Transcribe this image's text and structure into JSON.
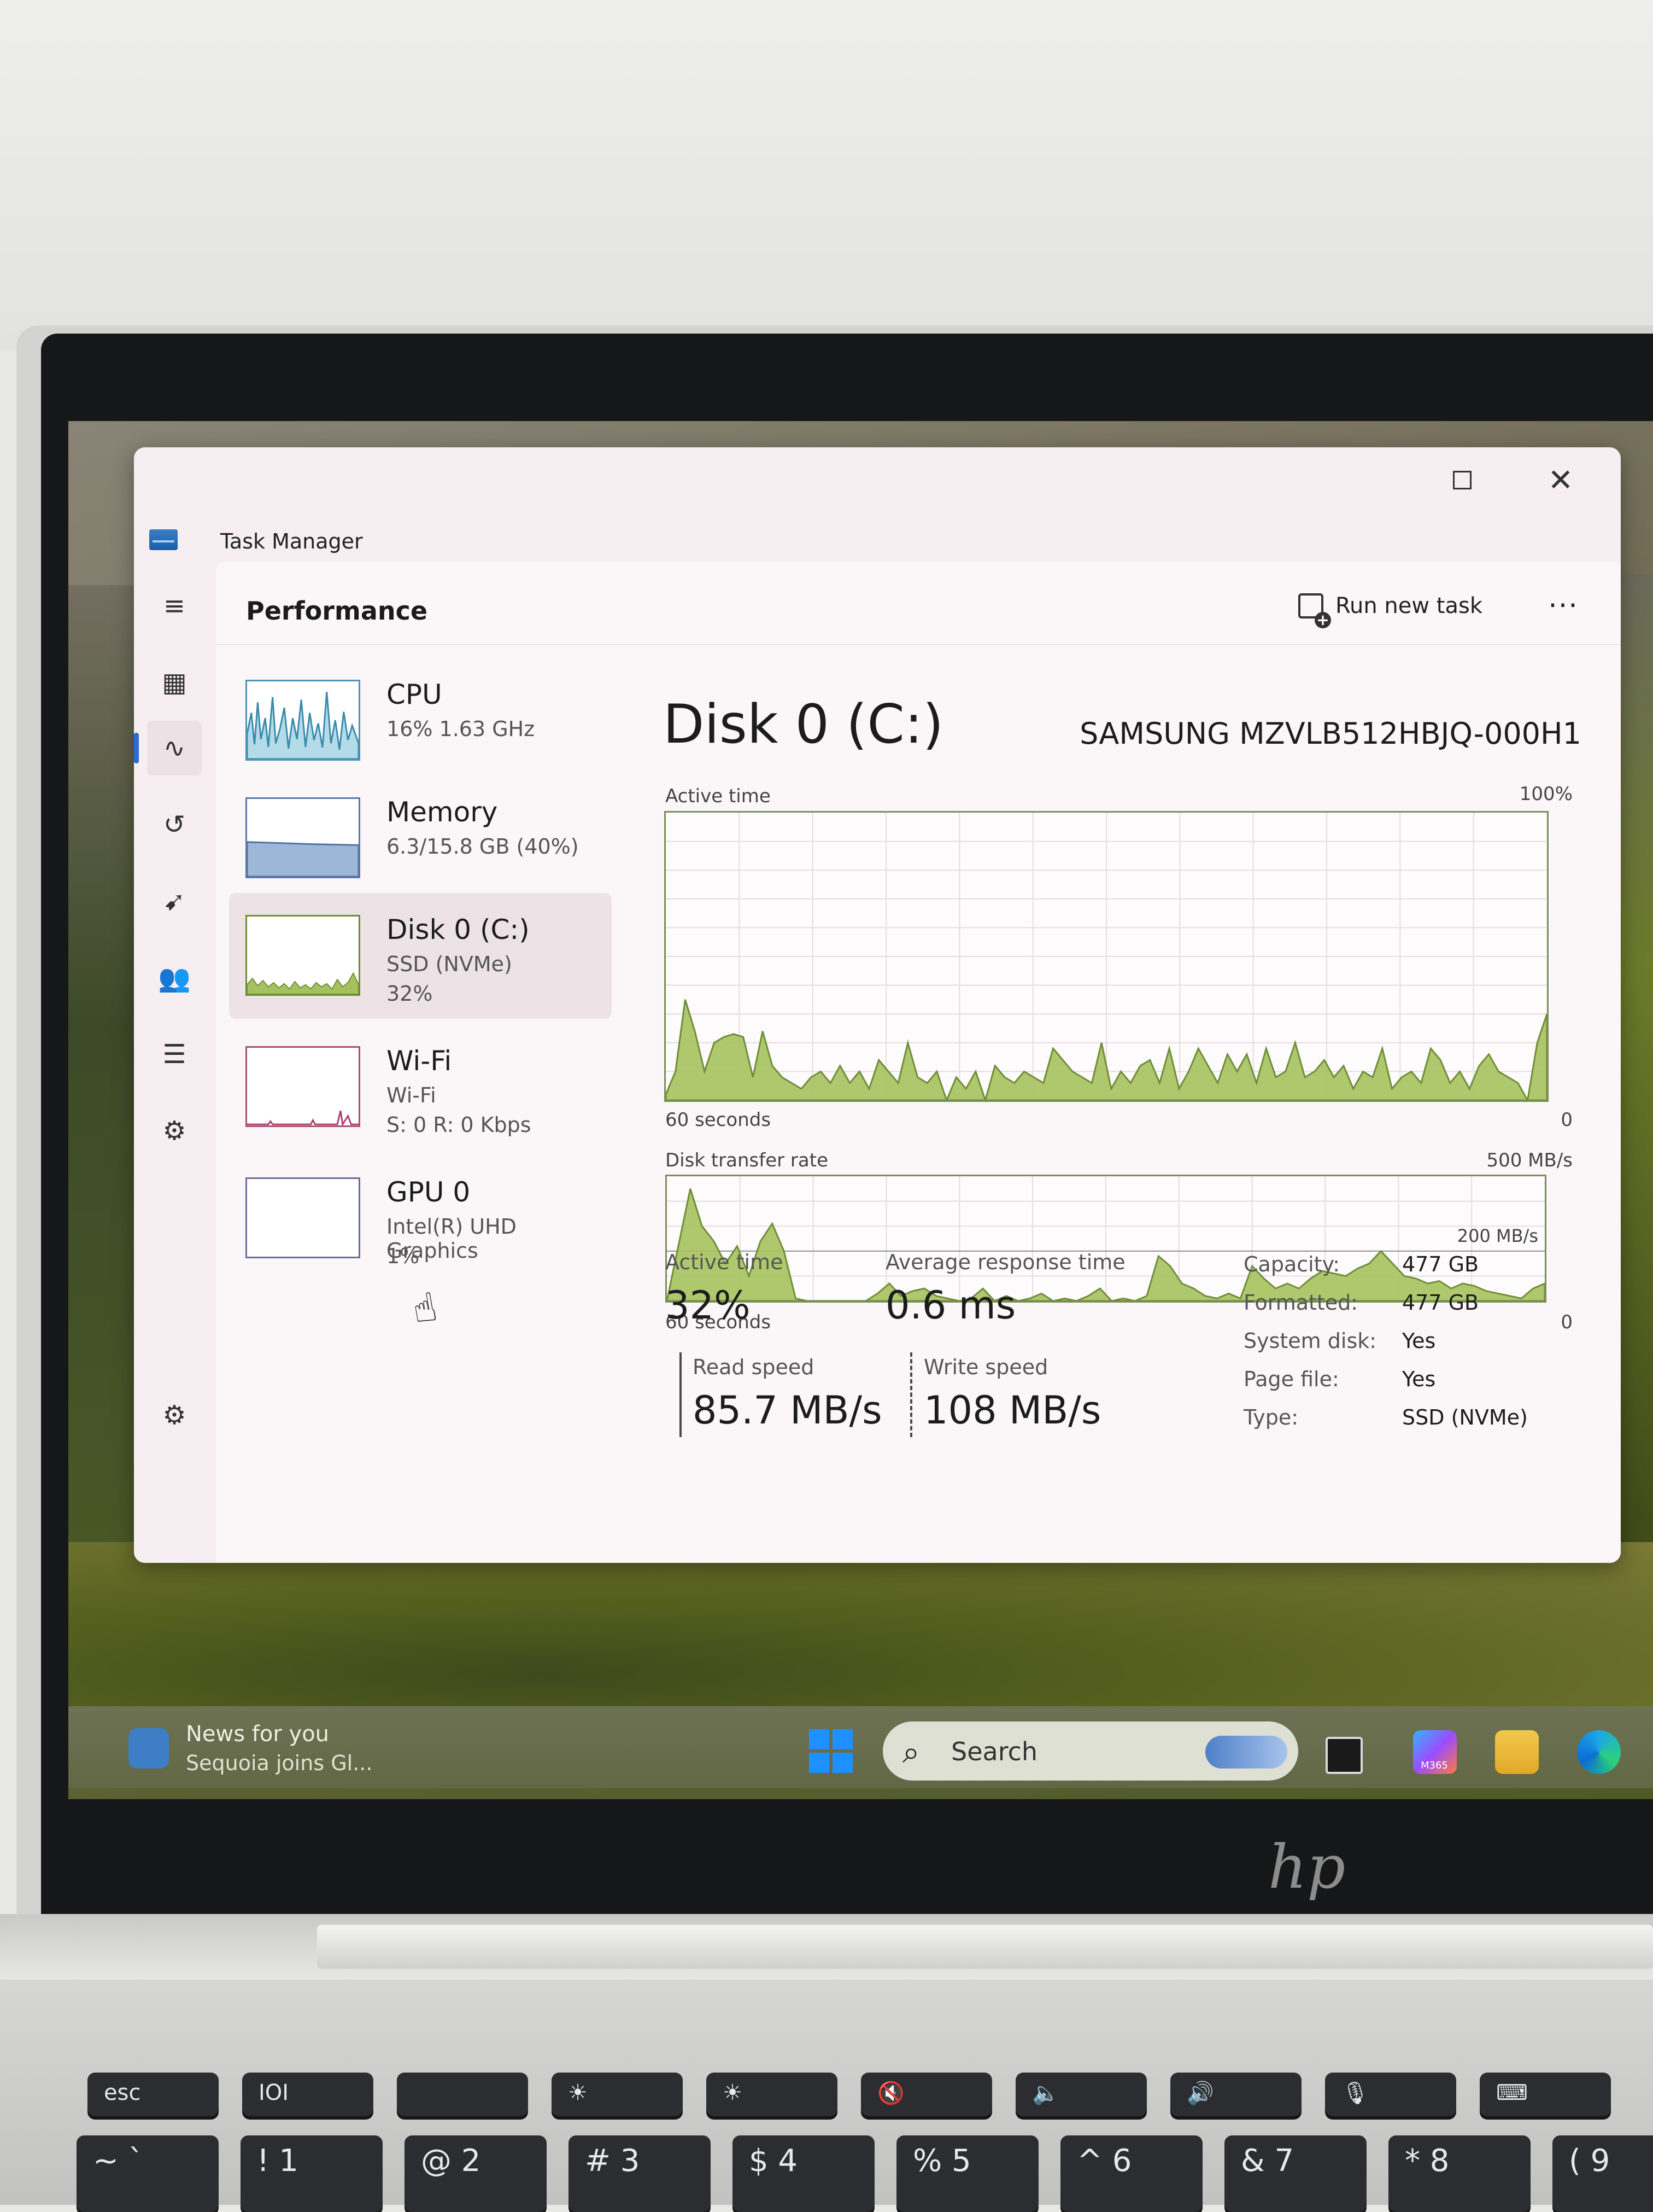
{
  "window": {
    "title": "Task Manager",
    "close_glyph": "✕"
  },
  "nav": {
    "items": [
      {
        "id": "hamburger",
        "icon": "≡"
      },
      {
        "id": "processes",
        "icon": "▦"
      },
      {
        "id": "performance",
        "icon": "∿"
      },
      {
        "id": "app-history",
        "icon": "↺"
      },
      {
        "id": "startup-apps",
        "icon": "➹"
      },
      {
        "id": "users",
        "icon": "👥"
      },
      {
        "id": "details",
        "icon": "☰"
      },
      {
        "id": "services",
        "icon": "⚙"
      }
    ],
    "settings_icon": "⚙"
  },
  "header": {
    "page_title": "Performance",
    "run_new_task": "Run new task",
    "more": "···"
  },
  "resources": [
    {
      "name": "CPU",
      "line1": "16%  1.63 GHz",
      "line2": ""
    },
    {
      "name": "Memory",
      "line1": "6.3/15.8 GB (40%)",
      "line2": ""
    },
    {
      "name": "Disk 0 (C:)",
      "line1": "SSD (NVMe)",
      "line2": "32%"
    },
    {
      "name": "Wi-Fi",
      "line1": "Wi-Fi",
      "line2": "S: 0  R: 0 Kbps"
    },
    {
      "name": "GPU 0",
      "line1": "Intel(R) UHD Graphics",
      "line2": "1%"
    }
  ],
  "detail": {
    "title": "Disk 0 (C:)",
    "model": "SAMSUNG MZVLB512HBJQ-000H1",
    "graph1": {
      "label": "Active time",
      "max": "100%",
      "x_left": "60 seconds",
      "x_right": "0",
      "values": [
        2,
        10,
        35,
        24,
        10,
        20,
        22,
        23,
        22,
        8,
        24,
        12,
        8,
        6,
        4,
        8,
        10,
        6,
        12,
        6,
        10,
        4,
        14,
        10,
        6,
        20,
        8,
        6,
        10,
        0,
        8,
        4,
        10,
        0,
        12,
        8,
        6,
        10,
        8,
        6,
        18,
        14,
        10,
        8,
        6,
        20,
        4,
        10,
        6,
        12,
        14,
        6,
        18,
        4,
        10,
        18,
        12,
        6,
        16,
        10,
        16,
        6,
        18,
        8,
        10,
        20,
        8,
        10,
        14,
        8,
        12,
        4,
        10,
        8,
        18,
        4,
        8,
        10,
        6,
        18,
        14,
        6,
        10,
        4,
        12,
        16,
        10,
        8,
        6,
        0,
        20,
        30
      ]
    },
    "graph2": {
      "label": "Disk transfer rate",
      "max": "500 MB/s",
      "ref_line": "200 MB/s",
      "x_left": "60 seconds",
      "x_right": "0",
      "values": [
        0,
        45,
        90,
        60,
        48,
        30,
        44,
        20,
        48,
        62,
        40,
        2,
        0,
        0,
        0,
        0,
        0,
        0,
        6,
        14,
        4,
        8,
        10,
        4,
        2,
        0,
        2,
        10,
        0,
        4,
        0,
        2,
        6,
        0,
        2,
        0,
        4,
        10,
        0,
        2,
        0,
        4,
        36,
        28,
        14,
        10,
        4,
        2,
        6,
        2,
        28,
        18,
        10,
        14,
        10,
        18,
        24,
        22,
        20,
        26,
        30,
        40,
        30,
        20,
        18,
        14,
        16,
        10,
        14,
        12,
        8,
        6,
        4,
        2,
        10,
        14
      ]
    },
    "stats": {
      "active_time_label": "Active time",
      "active_time_value": "32%",
      "avg_response_label": "Average response time",
      "avg_response_value": "0.6 ms",
      "read_label": "Read speed",
      "read_value": "85.7 MB/s",
      "write_label": "Write speed",
      "write_value": "108 MB/s"
    },
    "properties": [
      {
        "key": "Capacity:",
        "value": "477 GB"
      },
      {
        "key": "Formatted:",
        "value": "477 GB"
      },
      {
        "key": "System disk:",
        "value": "Yes"
      },
      {
        "key": "Page file:",
        "value": "Yes"
      },
      {
        "key": "Type:",
        "value": "SSD (NVMe)"
      }
    ]
  },
  "taskbar": {
    "news_title": "News for you",
    "news_sub": "Sequoia joins Gl...",
    "search_placeholder": "Search",
    "m365_label": "M365"
  },
  "keyboard": {
    "fn_row": [
      "esc",
      "IOI",
      "",
      "☀",
      "☀",
      "🔇",
      "🔈",
      "🔊",
      "🎙",
      "⌨"
    ],
    "num_row": [
      "~ `",
      "! 1",
      "@ 2",
      "# 3",
      "$ 4",
      "% 5",
      "^ 6",
      "& 7",
      "* 8",
      "( 9"
    ]
  },
  "brand": "hp",
  "colors": {
    "accent": "#2a6bd4",
    "disk_fill": "#a6c25e",
    "disk_line": "#6f8d38",
    "cpu_fill": "#a5cfe0",
    "memory_fill": "#9db7d9"
  }
}
